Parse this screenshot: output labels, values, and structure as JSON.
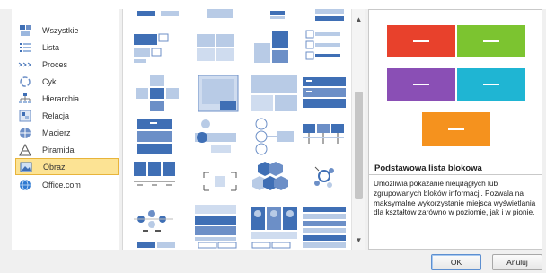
{
  "categories": [
    {
      "label": "Wszystkie",
      "icon": "all-layouts-icon",
      "selected": false
    },
    {
      "label": "Lista",
      "icon": "list-icon",
      "selected": false
    },
    {
      "label": "Proces",
      "icon": "process-icon",
      "selected": false
    },
    {
      "label": "Cykl",
      "icon": "cycle-icon",
      "selected": false
    },
    {
      "label": "Hierarchia",
      "icon": "hierarchy-icon",
      "selected": false
    },
    {
      "label": "Relacja",
      "icon": "relationship-icon",
      "selected": false
    },
    {
      "label": "Macierz",
      "icon": "matrix-icon",
      "selected": false
    },
    {
      "label": "Piramida",
      "icon": "pyramid-icon",
      "selected": false
    },
    {
      "label": "Obraz",
      "icon": "picture-icon",
      "selected": true
    },
    {
      "label": "Office.com",
      "icon": "office-com-icon",
      "selected": false
    }
  ],
  "preview": {
    "title": "Podstawowa lista blokowa",
    "description": "Umożliwia pokazanie niециągłych lub zgrupowanych bloków informacji. Pozwala na maksymalne wykorzystanie miejsca wyświetlania dla kształtów zarówno w poziomie, jak i w pionie.",
    "box_colors": [
      "#e8412c",
      "#7cc430",
      "#8a4fb5",
      "#1fb5d3",
      "#f5921e"
    ]
  },
  "buttons": {
    "ok": "OK",
    "cancel": "Anuluj"
  },
  "colors": {
    "accent": "#3f6fb5",
    "light_accent": "#b8cbe6",
    "selection": "#fce394"
  }
}
